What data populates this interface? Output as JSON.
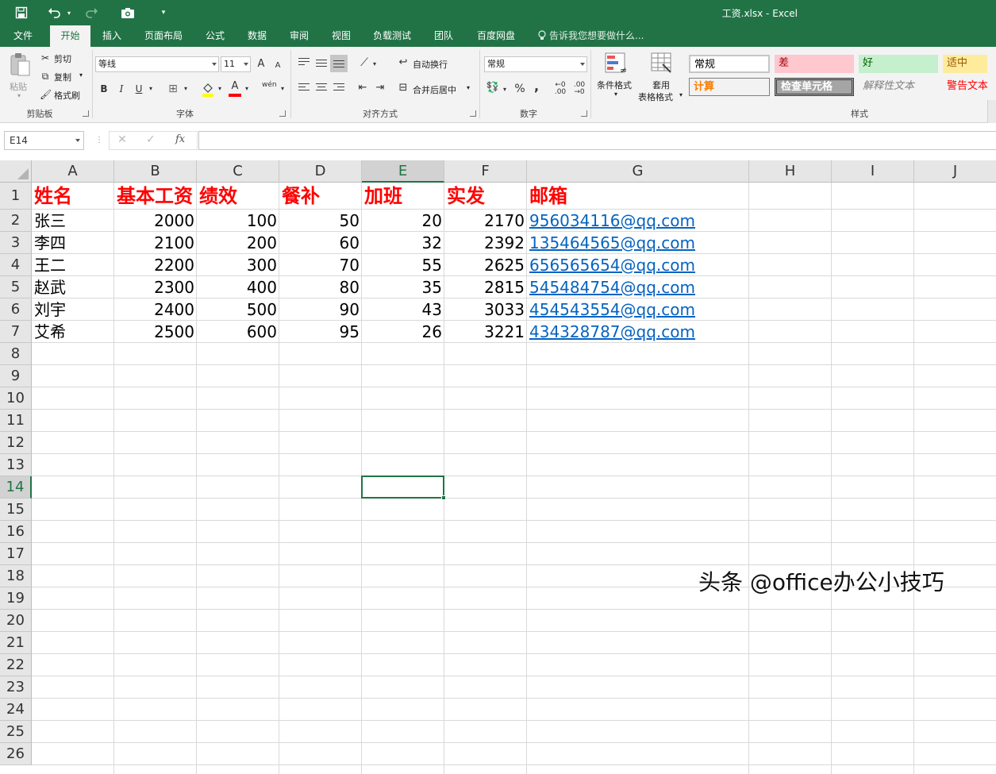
{
  "window": {
    "title": "工资.xlsx - Excel"
  },
  "quick_access": {
    "save_icon": "save-icon",
    "undo_icon": "undo-icon",
    "redo_icon": "redo-icon",
    "camera_icon": "camera-icon"
  },
  "tabs": [
    "文件",
    "开始",
    "插入",
    "页面布局",
    "公式",
    "数据",
    "审阅",
    "视图",
    "负载测试",
    "团队",
    "百度网盘"
  ],
  "active_tab": "开始",
  "tell_me": "告诉我您想要做什么...",
  "ribbon": {
    "clipboard": {
      "paste": "粘贴",
      "cut": "剪切",
      "copy": "复制",
      "format_painter": "格式刷",
      "label": "剪贴板"
    },
    "font": {
      "name": "等线",
      "size": "11",
      "grow": "A",
      "shrink": "A",
      "bold": "B",
      "italic": "I",
      "underline": "U",
      "font_color": "A",
      "phonetic": "wén",
      "label": "字体"
    },
    "alignment": {
      "wrap": "自动换行",
      "merge": "合并后居中",
      "label": "对齐方式"
    },
    "number": {
      "format": "常规",
      "percent": "%",
      "comma": ",",
      "label": "数字"
    },
    "styles": {
      "conditional": "条件格式",
      "table_line1": "套用",
      "table_line2": "表格格式",
      "normal": "常规",
      "bad": "差",
      "good": "好",
      "neutral": "适中",
      "calc": "计算",
      "check": "检查单元格",
      "explain": "解释性文本",
      "warning": "警告文本",
      "label": "样式"
    }
  },
  "formula_bar": {
    "name_box": "E14",
    "cancel": "✕",
    "enter": "✓",
    "fx": "fx",
    "value": ""
  },
  "columns": [
    "A",
    "B",
    "C",
    "D",
    "E",
    "F",
    "G",
    "H",
    "I",
    "J"
  ],
  "selected_col": "E",
  "rows": [
    "1",
    "2",
    "3",
    "4",
    "5",
    "6",
    "7",
    "8",
    "9",
    "10",
    "11",
    "12",
    "13",
    "14",
    "15",
    "16",
    "17",
    "18",
    "19",
    "20",
    "21",
    "22",
    "23",
    "24",
    "25",
    "26"
  ],
  "selected_row": "14",
  "sheet": {
    "headers": [
      "姓名",
      "基本工资",
      "绩效",
      "餐补",
      "加班",
      "实发",
      "邮箱"
    ],
    "records": [
      {
        "name": "张三",
        "base": "2000",
        "perf": "100",
        "meal": "50",
        "ot": "20",
        "net": "2170",
        "email": "956034116@qq.com"
      },
      {
        "name": "李四",
        "base": "2100",
        "perf": "200",
        "meal": "60",
        "ot": "32",
        "net": "2392",
        "email": "135464565@qq.com"
      },
      {
        "name": "王二",
        "base": "2200",
        "perf": "300",
        "meal": "70",
        "ot": "55",
        "net": "2625",
        "email": "656565654@qq.com"
      },
      {
        "name": "赵武",
        "base": "2300",
        "perf": "400",
        "meal": "80",
        "ot": "35",
        "net": "2815",
        "email": "545484754@qq.com"
      },
      {
        "name": "刘宇",
        "base": "2400",
        "perf": "500",
        "meal": "90",
        "ot": "43",
        "net": "3033",
        "email": "454543554@qq.com"
      },
      {
        "name": "艾希",
        "base": "2500",
        "perf": "600",
        "meal": "95",
        "ot": "26",
        "net": "3221",
        "email": "434328787@qq.com"
      }
    ]
  },
  "watermark": "头条 @office办公小技巧",
  "colors": {
    "accent": "#217346",
    "header_text": "#ff0000",
    "link": "#0563c1"
  }
}
